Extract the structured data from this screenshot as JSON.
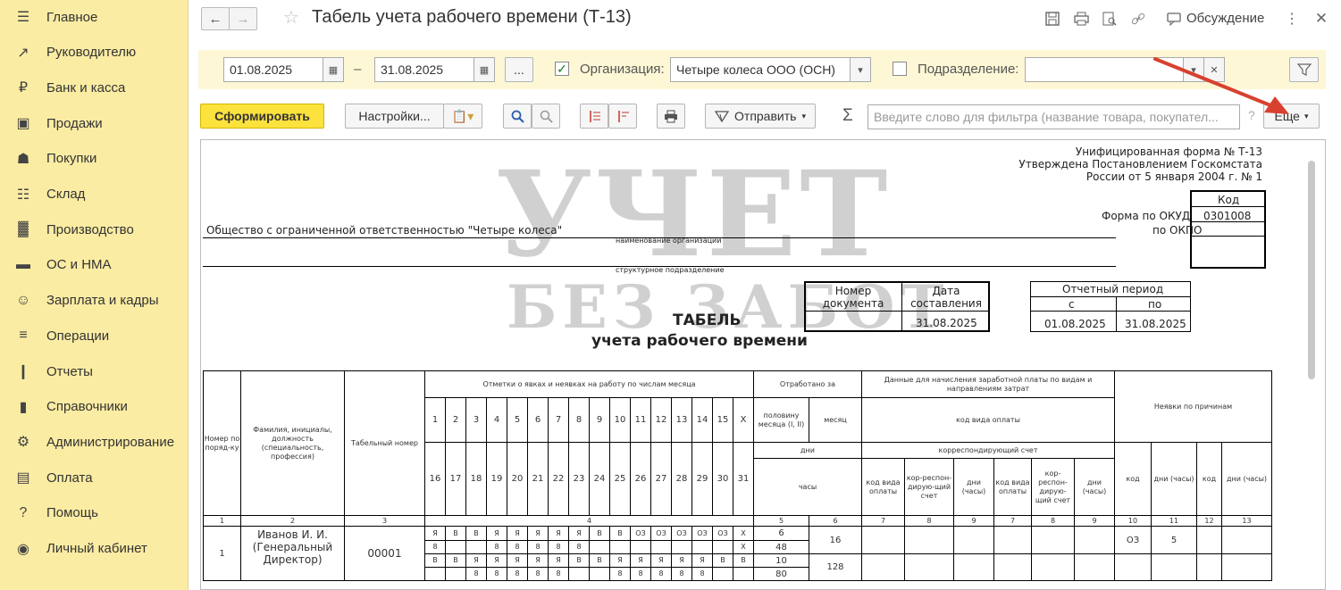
{
  "sidebar": {
    "items": [
      {
        "label": "Главное",
        "icon": "menu-icon"
      },
      {
        "label": "Руководителю",
        "icon": "trend-icon"
      },
      {
        "label": "Банк и касса",
        "icon": "ruble-icon"
      },
      {
        "label": "Продажи",
        "icon": "bag-icon"
      },
      {
        "label": "Покупки",
        "icon": "cart-icon"
      },
      {
        "label": "Склад",
        "icon": "warehouse-icon"
      },
      {
        "label": "Производство",
        "icon": "factory-icon"
      },
      {
        "label": "ОС и НМА",
        "icon": "truck-icon"
      },
      {
        "label": "Зарплата и кадры",
        "icon": "person-icon"
      },
      {
        "label": "Операции",
        "icon": "ledger-icon"
      },
      {
        "label": "Отчеты",
        "icon": "bar-chart-icon"
      },
      {
        "label": "Справочники",
        "icon": "book-icon"
      },
      {
        "label": "Администрирование",
        "icon": "gear-icon"
      },
      {
        "label": "Оплата",
        "icon": "wallet-icon"
      },
      {
        "label": "Помощь",
        "icon": "question-icon"
      },
      {
        "label": "Личный кабинет",
        "icon": "user-circle-icon"
      }
    ]
  },
  "header": {
    "title": "Табель учета рабочего времени (Т-13)",
    "discuss": "Обсуждение"
  },
  "filters": {
    "date_from": "01.08.2025",
    "date_sep": "–",
    "date_to": "31.08.2025",
    "period_btn": "...",
    "org_checked": true,
    "org_label": "Организация:",
    "org_value": "Четыре колеса ООО (ОСН)",
    "dept_checked": false,
    "dept_label": "Подразделение:",
    "dept_value": ""
  },
  "toolbar": {
    "generate": "Сформировать",
    "settings": "Настройки...",
    "send": "Отправить",
    "sigma": "Σ",
    "search_placeholder": "Введите слово для фильтра (название товара, покупател...",
    "help": "?",
    "more": "Еще"
  },
  "report": {
    "form_line1": "Унифицированная форма № Т-13",
    "form_line2": "Утверждена Постановлением Госкомстата",
    "form_line3": "России от 5 января 2004 г. № 1",
    "code_header": "Код",
    "okud_label": "Форма по ОКУД",
    "okud_value": "0301008",
    "okpo_label": "по ОКПО",
    "org_name": "Общество с ограниченной ответственностью \"Четыре колеса\"",
    "org_caption": "наименование организации",
    "dept_caption": "структурное подразделение",
    "doc_num_h": "Номер документа",
    "doc_date_h": "Дата составления",
    "doc_date": "31.08.2025",
    "period_h": "Отчетный период",
    "period_from_h": "с",
    "period_to_h": "по",
    "period_from": "01.08.2025",
    "period_to": "31.08.2025",
    "title1": "ТАБЕЛЬ",
    "title2": "учета  рабочего времени",
    "watermark1": "УЧЕТ",
    "watermark2": "БЕЗ ЗАБОТ",
    "grid": {
      "h_num": "Номер по поряд-ку",
      "h_fio": "Фамилия, инициалы, должность (специальность, профессия)",
      "h_tab": "Табельный номер",
      "h_marks": "Отметки о явках и неявках на работу по числам месяца",
      "h_worked": "Отработано за",
      "h_half": "половину месяца (I, II)",
      "h_month": "месяц",
      "h_days": "дни",
      "h_hours": "часы",
      "h_pay": "Данные для начисления заработной платы по видам и направлениям затрат",
      "h_paycode": "код вида оплаты",
      "h_corr": "корреспондирующий счет",
      "h_absence": "Неявки по причинам",
      "h_code_pay": "код вида оплаты",
      "h_corr_short": "кор-респон-дирую-щий счет",
      "h_days_hours": "дни (часы)",
      "h_code": "код",
      "days_row1": [
        "1",
        "2",
        "3",
        "4",
        "5",
        "6",
        "7",
        "8",
        "9",
        "10",
        "11",
        "12",
        "13",
        "14",
        "15",
        "X"
      ],
      "days_row2": [
        "16",
        "17",
        "18",
        "19",
        "20",
        "21",
        "22",
        "23",
        "24",
        "25",
        "26",
        "27",
        "28",
        "29",
        "30",
        "31"
      ],
      "col_nums": [
        "1",
        "2",
        "3",
        "4",
        "5",
        "6",
        "7",
        "8",
        "9",
        "7",
        "8",
        "9",
        "10",
        "11",
        "12",
        "13"
      ],
      "employee": {
        "num": "1",
        "name": "Иванов И. И.",
        "position": "(Генеральный Директор)",
        "tab": "00001",
        "marks1": [
          "Я",
          "В",
          "В",
          "Я",
          "Я",
          "Я",
          "Я",
          "Я",
          "В",
          "В",
          "ОЗ",
          "ОЗ",
          "ОЗ",
          "ОЗ",
          "ОЗ",
          "X"
        ],
        "hours1": [
          "8",
          "",
          "",
          "8",
          "8",
          "8",
          "8",
          "8",
          "",
          "",
          "",
          "",
          "",
          "",
          "",
          "X"
        ],
        "marks2": [
          "В",
          "В",
          "Я",
          "Я",
          "Я",
          "Я",
          "Я",
          "В",
          "В",
          "Я",
          "Я",
          "Я",
          "Я",
          "Я",
          "В",
          "В"
        ],
        "hours2": [
          "",
          "",
          "8",
          "8",
          "8",
          "8",
          "8",
          "",
          "",
          "8",
          "8",
          "8",
          "8",
          "8",
          "",
          ""
        ],
        "half1_days": "6",
        "half1_hours": "48",
        "half2_days": "10",
        "half2_hours": "80",
        "month_days": "16",
        "month_hours": "128",
        "absence_code": "ОЗ",
        "absence_days": "5"
      }
    }
  }
}
